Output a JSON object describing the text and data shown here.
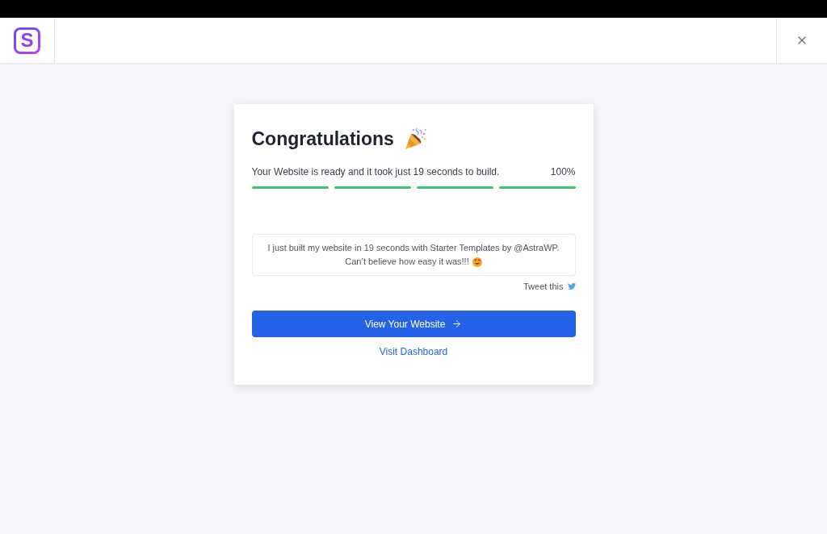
{
  "header": {
    "logo": "S"
  },
  "card": {
    "title": "Congratulations",
    "message": "Your Website is ready and it took just 19 seconds to build.",
    "progress": {
      "reading": "100%",
      "steps": [
        {
          "level": 1
        },
        {
          "level": 1
        },
        {
          "level": 1
        },
        {
          "level": 1
        }
      ]
    },
    "tweet": {
      "sentences": [
        "I just built my website in 19 seconds with Starter Templates by @AstraWP.",
        "Can’t believe how easy it was!!!"
      ]
    },
    "tweet_link": "Tweet this",
    "primary_button": "View Your Website",
    "secondary_link": "Visit Dashboard"
  }
}
